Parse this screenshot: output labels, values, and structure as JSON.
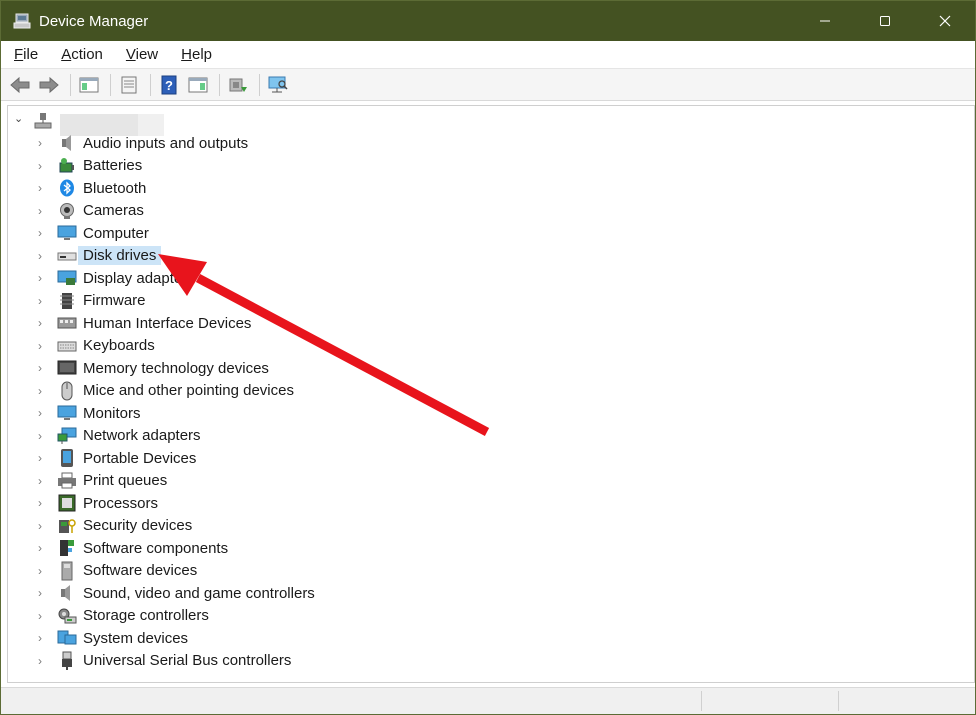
{
  "window": {
    "title": "Device Manager",
    "title_icon": "device-manager-icon",
    "controls": [
      "minimize-icon",
      "maximize-icon",
      "close-icon"
    ],
    "titlebar_color": "#445222"
  },
  "menu": [
    {
      "label": "File",
      "underline": "F",
      "rest": "ile"
    },
    {
      "label": "Action",
      "underline": "A",
      "rest": "ction"
    },
    {
      "label": "View",
      "underline": "V",
      "rest": "iew"
    },
    {
      "label": "Help",
      "underline": "H",
      "rest": "elp"
    }
  ],
  "toolbar": {
    "buttons": [
      "back-arrow-icon",
      "forward-arrow-icon",
      "show-hide-console-tree-icon",
      "properties-icon",
      "help-icon",
      "action-pane-icon",
      "update-driver-icon",
      "scan-hardware-icon"
    ]
  },
  "tree": {
    "root_name_redacted": true,
    "categories": [
      {
        "label": "Audio inputs and outputs",
        "icon": "speaker-icon"
      },
      {
        "label": "Batteries",
        "icon": "battery-icon"
      },
      {
        "label": "Bluetooth",
        "icon": "bluetooth-icon"
      },
      {
        "label": "Cameras",
        "icon": "camera-icon"
      },
      {
        "label": "Computer",
        "icon": "computer-icon"
      },
      {
        "label": "Disk drives",
        "icon": "disk-drive-icon",
        "selected": true
      },
      {
        "label": "Display adapte",
        "icon": "display-adapter-icon"
      },
      {
        "label": "Firmware",
        "icon": "firmware-icon"
      },
      {
        "label": "Human Interface Devices",
        "icon": "hid-icon"
      },
      {
        "label": "Keyboards",
        "icon": "keyboard-icon"
      },
      {
        "label": "Memory technology devices",
        "icon": "memory-icon"
      },
      {
        "label": "Mice and other pointing devices",
        "icon": "mouse-icon"
      },
      {
        "label": "Monitors",
        "icon": "monitor-icon"
      },
      {
        "label": "Network adapters",
        "icon": "network-icon"
      },
      {
        "label": "Portable Devices",
        "icon": "portable-device-icon"
      },
      {
        "label": "Print queues",
        "icon": "printer-icon"
      },
      {
        "label": "Processors",
        "icon": "processor-icon"
      },
      {
        "label": "Security devices",
        "icon": "security-icon"
      },
      {
        "label": "Software components",
        "icon": "software-component-icon"
      },
      {
        "label": "Software devices",
        "icon": "software-device-icon"
      },
      {
        "label": "Sound, video and game controllers",
        "icon": "sound-icon"
      },
      {
        "label": "Storage controllers",
        "icon": "storage-controller-icon"
      },
      {
        "label": "System devices",
        "icon": "system-device-icon"
      },
      {
        "label": "Universal Serial Bus controllers",
        "icon": "usb-icon"
      }
    ]
  },
  "annotation": {
    "arrow_color": "#e8141c",
    "points_to": "Disk drives"
  },
  "colors": {
    "selection": "#cce4f7"
  }
}
